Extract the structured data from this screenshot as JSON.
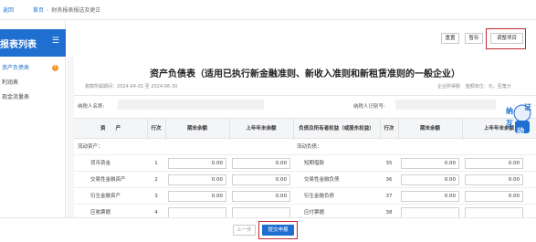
{
  "topbar": {
    "back_label": "返回",
    "breadcrumb": [
      "首页",
      "财务报表报送及更正"
    ]
  },
  "sidebar": {
    "title": "报表列表",
    "items": [
      {
        "label": "资产负债表",
        "badge": "!"
      },
      {
        "label": "利润表"
      },
      {
        "label": "现金流量表"
      }
    ]
  },
  "toolbar": {
    "buttons": [
      "重置",
      "暂存",
      "调整项目"
    ]
  },
  "document": {
    "title": "资产负债表（适用已执行新金融准则、新收入准则和新租赁准则的一般企业）",
    "period_label": "税款所属期间：",
    "period_start": "2024-04-01",
    "period_to": "至",
    "period_end": "2024-06-30",
    "unit_label": "企业所得税",
    "currency_label": "金额单位：",
    "currency_value": "元，至角分",
    "taxpayer_name_label": "纳税人名称:",
    "taxpayer_id_label": "纳税人识别号:",
    "headers": {
      "asset": "资　　产",
      "line": "行次",
      "end_balance": "期末余额",
      "prev_year_end": "上年年末余额",
      "liability": "负债及所有者权益（或股东权益）",
      "line2": "行次",
      "end_balance2": "期末余额",
      "prev_year_end2": "上年年末余额"
    },
    "section_left": "流动资产：",
    "section_right": "流动负债：",
    "rows": [
      {
        "asset": "货币资金",
        "line": "1",
        "end": "0.00",
        "prev": "0.00",
        "liab": "短期借款",
        "line2": "35",
        "end2": "0.00",
        "prev2": "0.00"
      },
      {
        "asset": "交易性金融资产",
        "line": "2",
        "end": "0.00",
        "prev": "0.00",
        "liab": "交易性金融负债",
        "line2": "36",
        "end2": "0.00",
        "prev2": "0.00"
      },
      {
        "asset": "衍生金融资产",
        "line": "3",
        "end": "0.00",
        "prev": "0.00",
        "liab": "衍生金融负债",
        "line2": "37",
        "end2": "0.00",
        "prev2": "0.00"
      },
      {
        "asset": "应收票据",
        "line": "4",
        "end": "",
        "prev": "",
        "liab": "应付票据",
        "line2": "38",
        "end2": "",
        "prev2": ""
      }
    ]
  },
  "bottom": {
    "prev_label": "上一步",
    "submit_label": "提交申报"
  },
  "mascot": {
    "chars": [
      "纳",
      "证",
      "互",
      "动"
    ]
  },
  "colors": {
    "accent": "#1f6fd1",
    "highlight": "#c0282f",
    "badge": "#f39a37"
  }
}
